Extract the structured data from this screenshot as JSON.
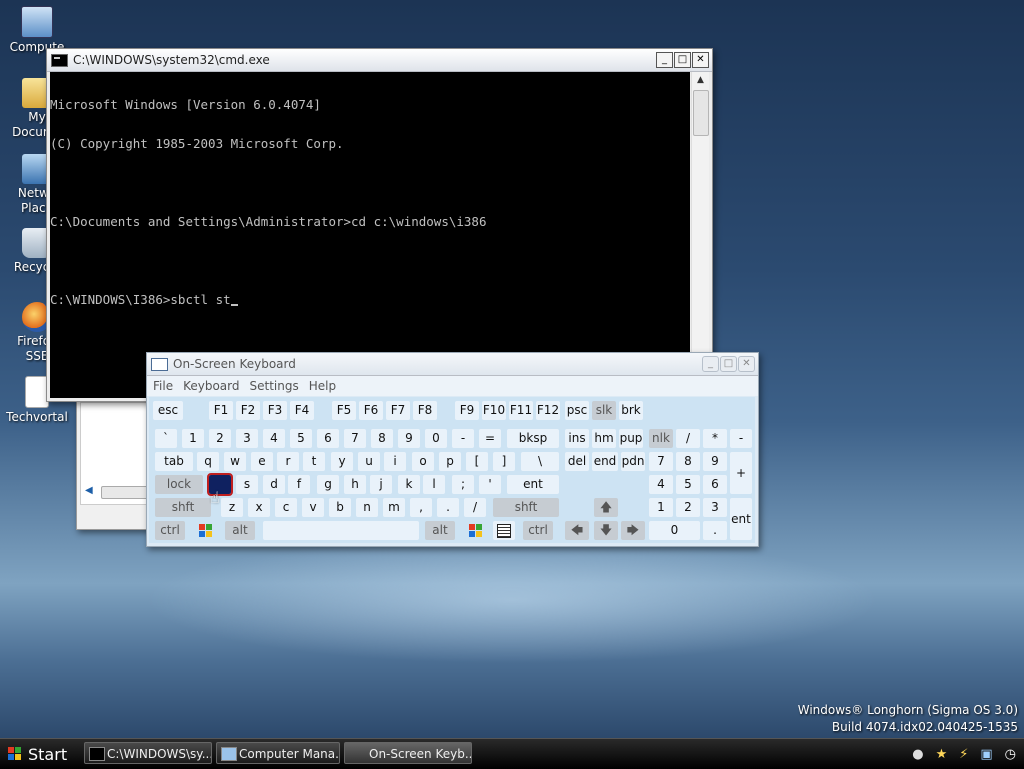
{
  "desktop": {
    "icons": [
      {
        "label": "Compute",
        "icon": "computer-icon"
      },
      {
        "label": "My Docume",
        "icon": "folder-icon"
      },
      {
        "label": "Netwo Place",
        "icon": "network-icon"
      },
      {
        "label": "Recycle",
        "icon": "recycle-bin-icon"
      },
      {
        "label": "Firefox SSE",
        "icon": "firefox-icon"
      },
      {
        "label": "Techvortal",
        "icon": "document-icon"
      }
    ]
  },
  "cmd": {
    "title": "C:\\WINDOWS\\system32\\cmd.exe",
    "lines": [
      "Microsoft Windows [Version 6.0.4074]",
      "(C) Copyright 1985-2003 Microsoft Corp.",
      "",
      "C:\\Documents and Settings\\Administrator>cd c:\\windows\\i386",
      "",
      "C:\\WINDOWS\\I386>sbctl st"
    ],
    "buttons": {
      "minimize": "_",
      "maximize": "□",
      "close": "✕"
    }
  },
  "osk": {
    "title": "On-Screen Keyboard",
    "menu": [
      "File",
      "Keyboard",
      "Settings",
      "Help"
    ],
    "buttons": {
      "minimize": "_",
      "maximize": "□",
      "close": "✕"
    }
  },
  "watermark": {
    "line1": "Windows® Longhorn (Sigma OS 3.0)",
    "line2": "Build 4074.idx02.040425-1535"
  },
  "taskbar": {
    "start": "Start",
    "tasks": [
      "C:\\WINDOWS\\sy...",
      "Computer Mana...",
      "On-Screen Keyb..."
    ]
  }
}
